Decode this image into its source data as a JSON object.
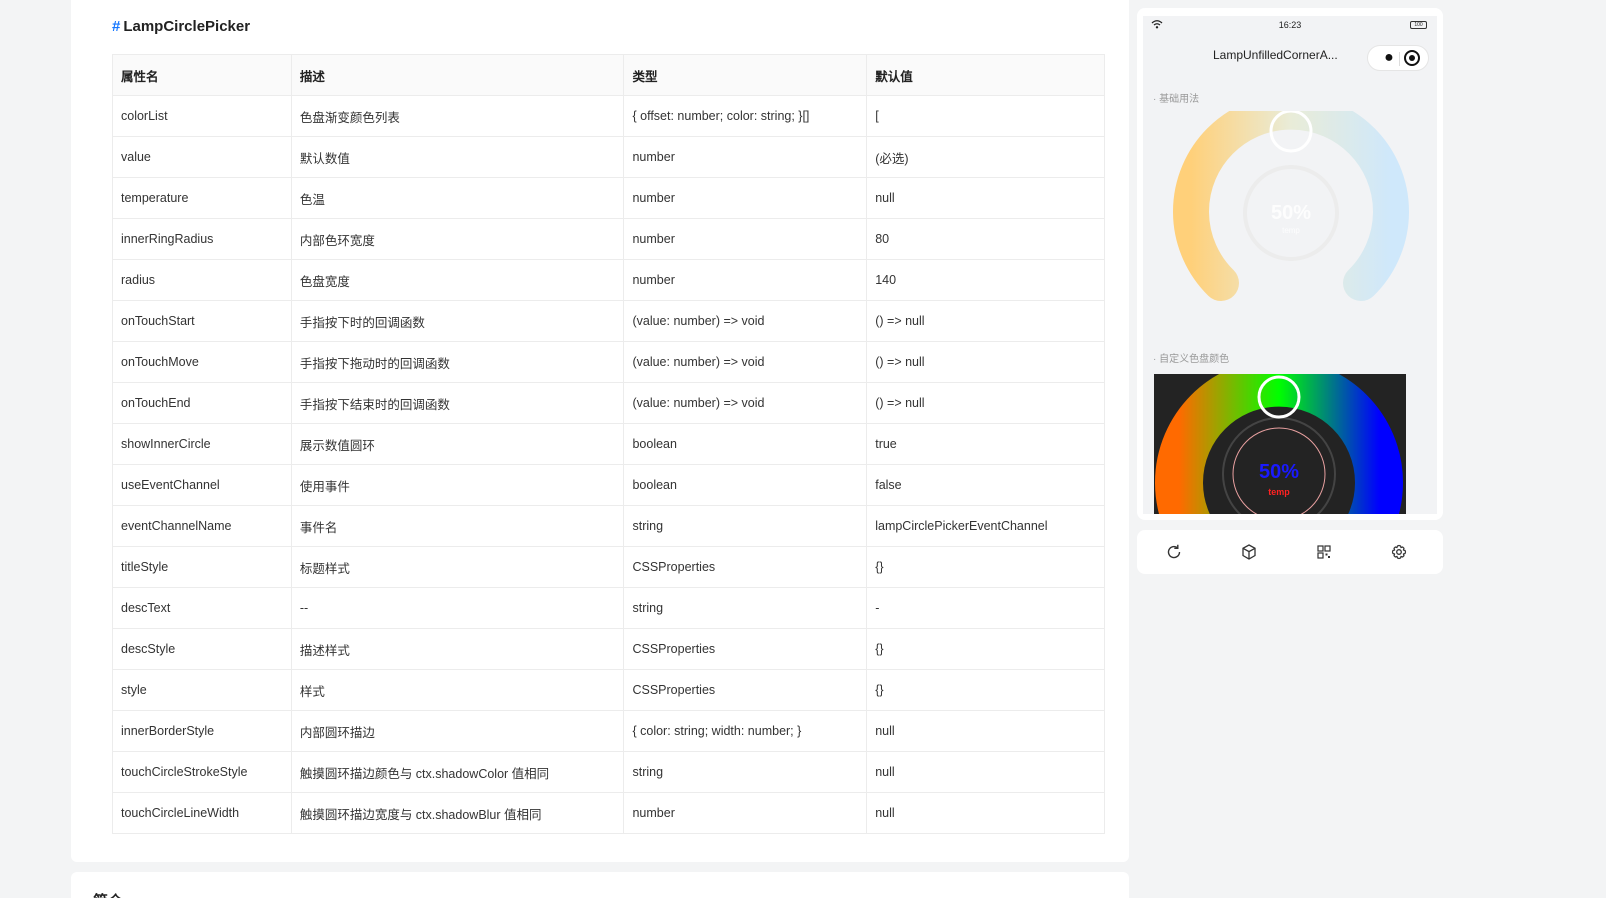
{
  "doc": {
    "heading_hash": "#",
    "heading": "LampCirclePicker",
    "next_section_title": "简介",
    "table": {
      "headers": [
        "属性名",
        "描述",
        "类型",
        "默认值"
      ],
      "rows": [
        [
          "colorList",
          "色盘渐变颜色列表",
          "{ offset: number; color: string; }[]",
          "["
        ],
        [
          "value",
          "默认数值",
          "number",
          "(必选)"
        ],
        [
          "temperature",
          "色温",
          "number",
          "null"
        ],
        [
          "innerRingRadius",
          "内部色环宽度",
          "number",
          "80"
        ],
        [
          "radius",
          "色盘宽度",
          "number",
          "140"
        ],
        [
          "onTouchStart",
          "手指按下时的回调函数",
          "(value: number) => void",
          "() => null"
        ],
        [
          "onTouchMove",
          "手指按下拖动时的回调函数",
          "(value: number) => void",
          "() => null"
        ],
        [
          "onTouchEnd",
          "手指按下结束时的回调函数",
          "(value: number) => void",
          "() => null"
        ],
        [
          "showInnerCircle",
          "展示数值圆环",
          "boolean",
          "true"
        ],
        [
          "useEventChannel",
          "使用事件",
          "boolean",
          "false"
        ],
        [
          "eventChannelName",
          "事件名",
          "string",
          "lampCirclePickerEventChannel"
        ],
        [
          "titleStyle",
          "标题样式",
          "CSSProperties",
          "{}"
        ],
        [
          "descText",
          "--",
          "string",
          "-"
        ],
        [
          "descStyle",
          "描述样式",
          "CSSProperties",
          "{}"
        ],
        [
          "style",
          "样式",
          "CSSProperties",
          "{}"
        ],
        [
          "innerBorderStyle",
          "内部圆环描边",
          "{ color: string; width: number; }",
          "null"
        ],
        [
          "touchCircleStrokeStyle",
          "触摸圆环描边颜色与 ctx.shadowColor 值相同",
          "string",
          "null"
        ],
        [
          "touchCircleLineWidth",
          "触摸圆环描边宽度与 ctx.shadowBlur 值相同",
          "number",
          "null"
        ]
      ]
    }
  },
  "phone": {
    "status_time": "16:23",
    "battery": "100",
    "nav_title": "LampUnfilledCornerA...",
    "capsule_more": "●",
    "section1_label": "基础用法",
    "section2_label": "自定义色盘颜色",
    "picker1": {
      "value_text": "50%",
      "desc_text": "temp",
      "colors": [
        "#ffd07a",
        "#e9ecd8",
        "#cfe8fb"
      ]
    },
    "picker2": {
      "value_text": "50%",
      "desc_text": "temp",
      "value_color": "#1a1aff",
      "desc_color": "#ff2222",
      "colors": [
        "#ff6a00",
        "#00ff00",
        "#0000ff"
      ]
    }
  },
  "toolbar": {
    "icons": [
      "refresh-icon",
      "cube-icon",
      "qrcode-icon",
      "settings-icon"
    ]
  }
}
